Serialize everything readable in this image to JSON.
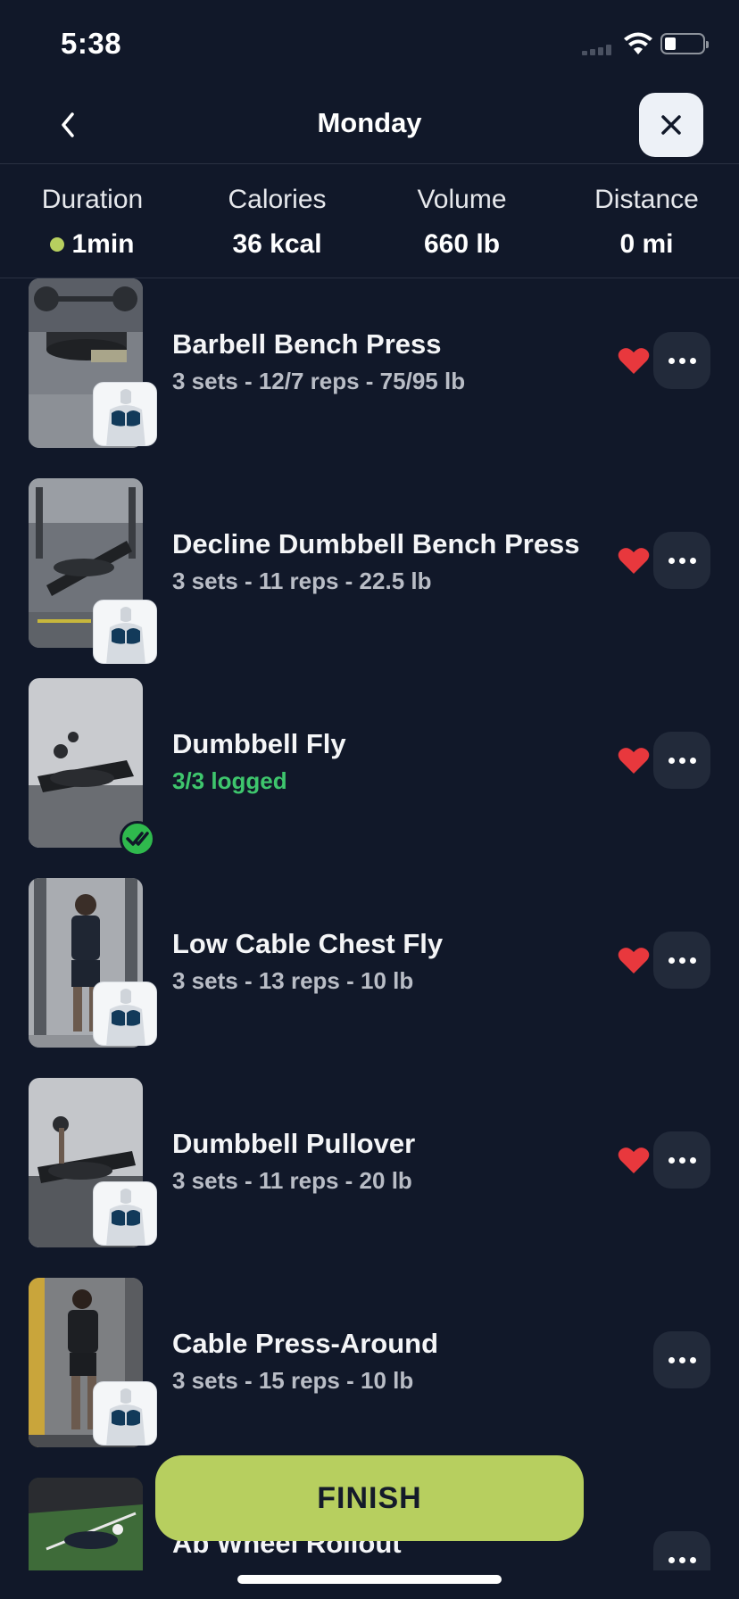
{
  "status_bar": {
    "time": "5:38"
  },
  "header": {
    "title": "Monday"
  },
  "stats": [
    {
      "label": "Duration",
      "value": "1min",
      "live": true
    },
    {
      "label": "Calories",
      "value": "36 kcal"
    },
    {
      "label": "Volume",
      "value": "660 lb"
    },
    {
      "label": "Distance",
      "value": "0 mi"
    }
  ],
  "exercises": [
    {
      "name": "Barbell Bench Press",
      "detail": "3 sets - 12/7 reps - 75/95 lb",
      "favorite": true,
      "completed": false
    },
    {
      "name": "Decline Dumbbell Bench Press",
      "detail": "3 sets - 11 reps - 22.5 lb",
      "favorite": true,
      "completed": false
    },
    {
      "name": "Dumbbell Fly",
      "detail": "3/3 logged",
      "favorite": true,
      "completed": true
    },
    {
      "name": "Low Cable Chest Fly",
      "detail": "3 sets - 13 reps - 10 lb",
      "favorite": true,
      "completed": false
    },
    {
      "name": "Dumbbell Pullover",
      "detail": "3 sets - 11 reps - 20 lb",
      "favorite": true,
      "completed": false
    },
    {
      "name": "Cable Press-Around",
      "detail": "3 sets - 15 reps - 10 lb",
      "favorite": false,
      "completed": false
    },
    {
      "name": "Ab Wheel Rollout",
      "detail": "",
      "favorite": false,
      "completed": false
    }
  ],
  "finish_label": "FINISH",
  "colors": {
    "background": "#111829",
    "accent": "#b7cf5f",
    "logged": "#3ec66d",
    "heart": "#e8383d"
  }
}
